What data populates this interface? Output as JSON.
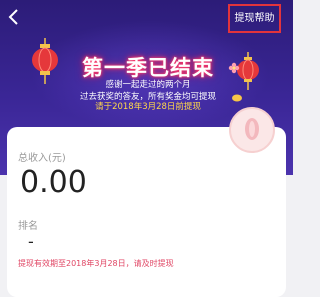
{
  "header": {
    "help_label": "提现帮助"
  },
  "hero": {
    "title": "第一季已结束",
    "line1": "感谢一起走过的两个月",
    "line2": "过去获奖的答友，所有奖金均可提现",
    "line3": "请于2018年3月28日前提现"
  },
  "stats": {
    "income_label": "总收入(元)",
    "income_value": "0.00",
    "rank_label": "排名",
    "rank_value": "-"
  },
  "notice": "提现有效期至2018年3月28日，请及时提现",
  "colors": {
    "hero_bg": "#3a2696",
    "highlight_border": "#e2343c",
    "notice_text": "#e04664",
    "deadline_text": "#ffd84a"
  },
  "icons": {
    "back": "chevron-left-icon",
    "lantern": "lantern-icon",
    "decor": "avatar-bubble"
  }
}
